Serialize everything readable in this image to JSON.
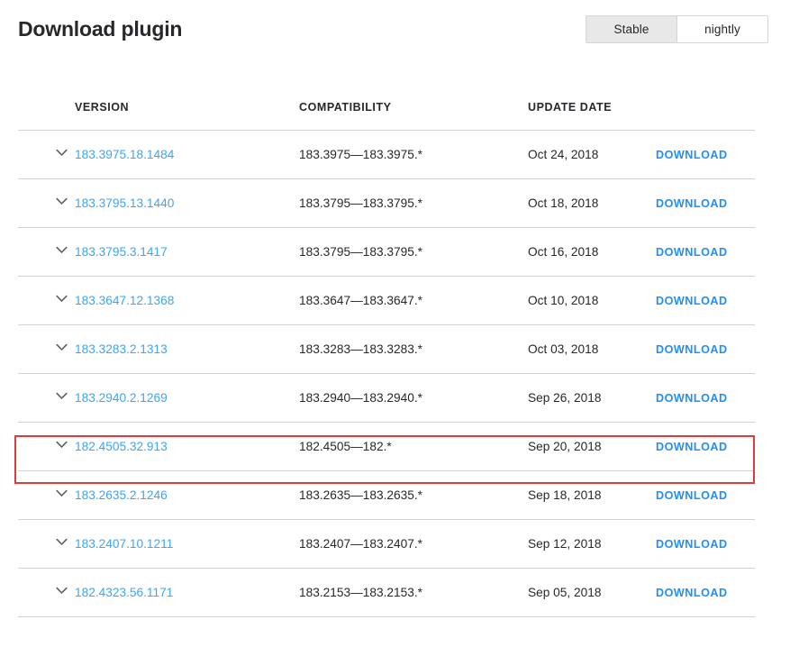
{
  "header": {
    "title": "Download plugin",
    "channels": [
      {
        "label": "Stable",
        "selected": true
      },
      {
        "label": "nightly",
        "selected": false
      }
    ]
  },
  "table": {
    "columns": [
      "",
      "VERSION",
      "COMPATIBILITY",
      "UPDATE DATE",
      ""
    ],
    "headers": {
      "version": "VERSION",
      "compatibility": "COMPATIBILITY",
      "update_date": "UPDATE DATE"
    },
    "action_label": "DOWNLOAD",
    "expand_icon": "chevron-down-icon",
    "rows": [
      {
        "version": "183.3975.18.1484",
        "compatibility": "183.3975—183.3975.*",
        "update_date": "Oct 24, 2018",
        "action": "DOWNLOAD",
        "highlighted": false
      },
      {
        "version": "183.3795.13.1440",
        "compatibility": "183.3795—183.3795.*",
        "update_date": "Oct 18, 2018",
        "action": "DOWNLOAD",
        "highlighted": false
      },
      {
        "version": "183.3795.3.1417",
        "compatibility": "183.3795—183.3795.*",
        "update_date": "Oct 16, 2018",
        "action": "DOWNLOAD",
        "highlighted": false
      },
      {
        "version": "183.3647.12.1368",
        "compatibility": "183.3647—183.3647.*",
        "update_date": "Oct 10, 2018",
        "action": "DOWNLOAD",
        "highlighted": false
      },
      {
        "version": "183.3283.2.1313",
        "compatibility": "183.3283—183.3283.*",
        "update_date": "Oct 03, 2018",
        "action": "DOWNLOAD",
        "highlighted": false
      },
      {
        "version": "183.2940.2.1269",
        "compatibility": "183.2940—183.2940.*",
        "update_date": "Sep 26, 2018",
        "action": "DOWNLOAD",
        "highlighted": false
      },
      {
        "version": "182.4505.32.913",
        "compatibility": "182.4505—182.*",
        "update_date": "Sep 20, 2018",
        "action": "DOWNLOAD",
        "highlighted": true
      },
      {
        "version": "183.2635.2.1246",
        "compatibility": "183.2635—183.2635.*",
        "update_date": "Sep 18, 2018",
        "action": "DOWNLOAD",
        "highlighted": false
      },
      {
        "version": "183.2407.10.1211",
        "compatibility": "183.2407—183.2407.*",
        "update_date": "Sep 12, 2018",
        "action": "DOWNLOAD",
        "highlighted": false
      },
      {
        "version": "182.4323.56.1171",
        "compatibility": "183.2153—183.2153.*",
        "update_date": "Sep 05, 2018",
        "action": "DOWNLOAD",
        "highlighted": false
      }
    ]
  },
  "colors": {
    "link_blue": "#3ba6f5",
    "action_blue": "#1e8ffa",
    "text_dark": "#27282c",
    "row_border": "#d2d2d2",
    "highlight_red": "#e33b3b",
    "toggle_selected_bg": "#e8e8e8"
  }
}
